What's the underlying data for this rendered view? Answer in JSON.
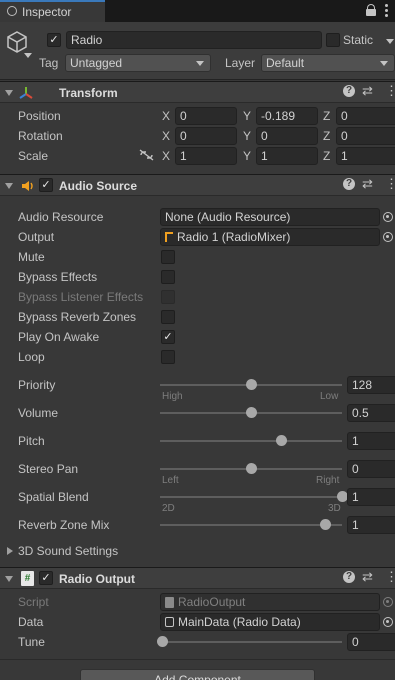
{
  "window": {
    "tab_label": "Inspector",
    "lock_icon": "lock-icon",
    "menu_icon": "kebab-menu-icon"
  },
  "gameobject": {
    "active": true,
    "name": "Radio",
    "static_label": "Static",
    "static_checked": false,
    "tag_label": "Tag",
    "tag_value": "Untagged",
    "layer_label": "Layer",
    "layer_value": "Default"
  },
  "transform": {
    "title": "Transform",
    "position": {
      "label": "Position",
      "x": "0",
      "y": "-0.189",
      "z": "0"
    },
    "rotation": {
      "label": "Rotation",
      "x": "0",
      "y": "0",
      "z": "0"
    },
    "scale": {
      "label": "Scale",
      "x": "1",
      "y": "1",
      "z": "1"
    },
    "axis_x": "X",
    "axis_y": "Y",
    "axis_z": "Z"
  },
  "audio_source": {
    "title": "Audio Source",
    "enabled": true,
    "audio_resource": {
      "label": "Audio Resource",
      "value": "None (Audio Resource)"
    },
    "output": {
      "label": "Output",
      "value": "Radio 1 (RadioMixer)"
    },
    "mute": {
      "label": "Mute",
      "checked": false
    },
    "bypass_effects": {
      "label": "Bypass Effects",
      "checked": false
    },
    "bypass_listener_effects": {
      "label": "Bypass Listener Effects",
      "checked": false
    },
    "bypass_reverb_zones": {
      "label": "Bypass Reverb Zones",
      "checked": false
    },
    "play_on_awake": {
      "label": "Play On Awake",
      "checked": true,
      "mark": "✓"
    },
    "loop": {
      "label": "Loop",
      "checked": false
    },
    "priority": {
      "label": "Priority",
      "value": "128",
      "level": 0.5,
      "min_hint": "High",
      "max_hint": "Low"
    },
    "volume": {
      "label": "Volume",
      "value": "0.5",
      "level": 0.5
    },
    "pitch": {
      "label": "Pitch",
      "value": "1",
      "level": 0.667
    },
    "stereo_pan": {
      "label": "Stereo Pan",
      "value": "0",
      "level": 0.5,
      "min_hint": "Left",
      "max_hint": "Right"
    },
    "spatial_blend": {
      "label": "Spatial Blend",
      "value": "1",
      "level": 1.0,
      "min_hint": "2D",
      "max_hint": "3D"
    },
    "reverb_zone_mix": {
      "label": "Reverb Zone Mix",
      "value": "1",
      "level": 0.909
    },
    "sound_settings_label": "3D Sound Settings"
  },
  "radio_output": {
    "title": "Radio Output",
    "enabled": true,
    "script": {
      "label": "Script",
      "value": "RadioOutput"
    },
    "data": {
      "label": "Data",
      "value": "MainData (Radio Data)"
    },
    "tune": {
      "label": "Tune",
      "value": "0",
      "level": 0.0
    }
  },
  "add_component_label": "Add Component",
  "colors": {
    "accent": "#3a79bb",
    "panel": "#383838",
    "field": "#2a2a2a",
    "header": "#3e3e3e"
  }
}
